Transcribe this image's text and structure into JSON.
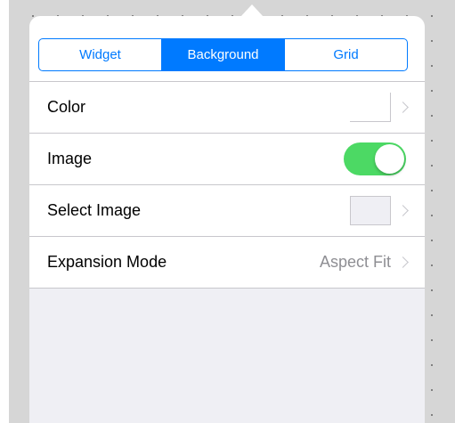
{
  "segmented_control": {
    "segments": [
      {
        "label": "Widget"
      },
      {
        "label": "Background"
      },
      {
        "label": "Grid"
      }
    ],
    "selected": "Background"
  },
  "rows": {
    "color": {
      "label": "Color"
    },
    "image": {
      "label": "Image",
      "toggle_on": true
    },
    "select_image": {
      "label": "Select Image"
    },
    "expansion_mode": {
      "label": "Expansion Mode",
      "value": "Aspect Fit"
    }
  },
  "icons": {
    "disclosure": "chevron-right-icon"
  },
  "colors": {
    "accent": "#007aff",
    "toggle_on": "#4cd964",
    "canvas": "#d6d6d6",
    "grouped_background": "#efeff4",
    "separator": "#c8c7cc",
    "detail_text": "#8e8e93"
  }
}
